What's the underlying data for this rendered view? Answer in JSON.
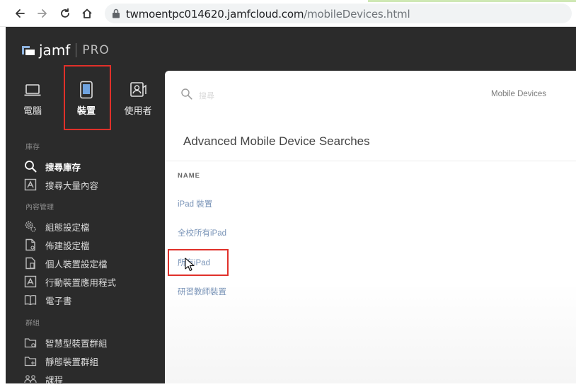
{
  "browser": {
    "url_host": "twmoentpc014620.jamfcloud.com",
    "url_path": "/mobileDevices.html"
  },
  "app": {
    "logo_name": "jamf",
    "logo_edition": "PRO"
  },
  "top_nav": [
    {
      "label": "電腦",
      "icon": "laptop-icon"
    },
    {
      "label": "裝置",
      "icon": "mobile-device-icon",
      "active": true
    },
    {
      "label": "使用者",
      "icon": "user-icon"
    }
  ],
  "sidebar": {
    "sections": [
      {
        "title": "庫存",
        "items": [
          {
            "label": "搜尋庫存",
            "icon": "search-icon",
            "bold": true
          },
          {
            "label": "搜尋大量內容",
            "icon": "volume-content-icon"
          }
        ]
      },
      {
        "title": "內容管理",
        "items": [
          {
            "label": "組態設定檔",
            "icon": "gear-icon"
          },
          {
            "label": "佈建設定檔",
            "icon": "document-icon"
          },
          {
            "label": "個人裝置設定檔",
            "icon": "personal-device-icon"
          },
          {
            "label": "行動裝置應用程式",
            "icon": "app-store-icon"
          },
          {
            "label": "電子書",
            "icon": "book-icon"
          }
        ]
      },
      {
        "title": "群組",
        "items": [
          {
            "label": "智慧型裝置群組",
            "icon": "smart-folder-icon"
          },
          {
            "label": "靜態裝置群組",
            "icon": "static-folder-icon"
          },
          {
            "label": "課程",
            "icon": "classes-icon"
          }
        ]
      }
    ]
  },
  "content": {
    "search_placeholder": "搜尋",
    "breadcrumb": "Mobile Devices",
    "title": "Advanced Mobile Device Searches",
    "column_name": "NAME",
    "results": [
      {
        "name": "iPad 裝置"
      },
      {
        "name": "全校所有iPad"
      },
      {
        "name": "所有iPad"
      },
      {
        "name": "研習教師裝置"
      }
    ]
  },
  "colors": {
    "sidebar_bg": "#2b2b2b",
    "link": "#7b95b8",
    "highlight": "#e0302a"
  }
}
